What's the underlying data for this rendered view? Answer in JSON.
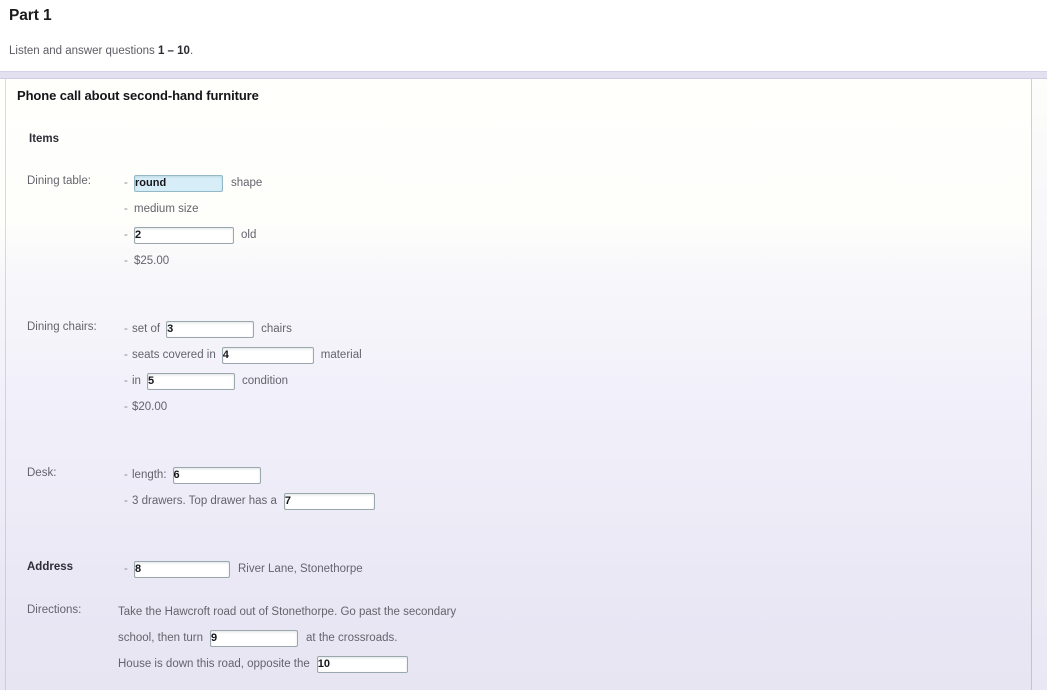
{
  "header": {
    "part_title": "Part 1",
    "instruction_prefix": "Listen and answer questions ",
    "instruction_range": "1 – 10",
    "instruction_suffix": "."
  },
  "panel": {
    "section_title": "Phone call about second-hand furniture",
    "items_heading": "Items"
  },
  "rows": {
    "dining_table": {
      "label": "Dining table:",
      "dash": "-",
      "example_value": "round",
      "after_example": "shape",
      "medium_size": "medium size",
      "q2": "2",
      "after_q2": "old",
      "price": "$25.00"
    },
    "dining_chairs": {
      "label": "Dining chairs:",
      "dash": "-",
      "set_of": "set of",
      "q3": "3",
      "after_q3": "chairs",
      "seats_covered": "seats covered in",
      "q4": "4",
      "after_q4": "material",
      "in_word": "in",
      "q5": "5",
      "after_q5": "condition",
      "price": "$20.00"
    },
    "desk": {
      "label": "Desk:",
      "dash": "-",
      "length_label": "length:",
      "q6": "6",
      "drawers_text": "3 drawers. Top drawer has a",
      "q7": "7"
    },
    "address": {
      "label": "Address",
      "dash": "-",
      "q8": "8",
      "after_q8": "River Lane, Stonethorpe"
    },
    "directions": {
      "label": "Directions:",
      "line1": "Take the Hawcroft road out of Stonethorpe. Go past the secondary",
      "line2_before": "school, then turn",
      "q9": "9",
      "line2_after": "at the crossroads.",
      "line3_before": "House is down this road, opposite the",
      "q10": "10"
    }
  },
  "colors": {
    "example_fill": "#d7eef8",
    "box_border": "#9aa7ad",
    "divider_band": "#e3e1f0",
    "panel_top": "#fffffc",
    "panel_bottom": "#e7e5f2"
  }
}
